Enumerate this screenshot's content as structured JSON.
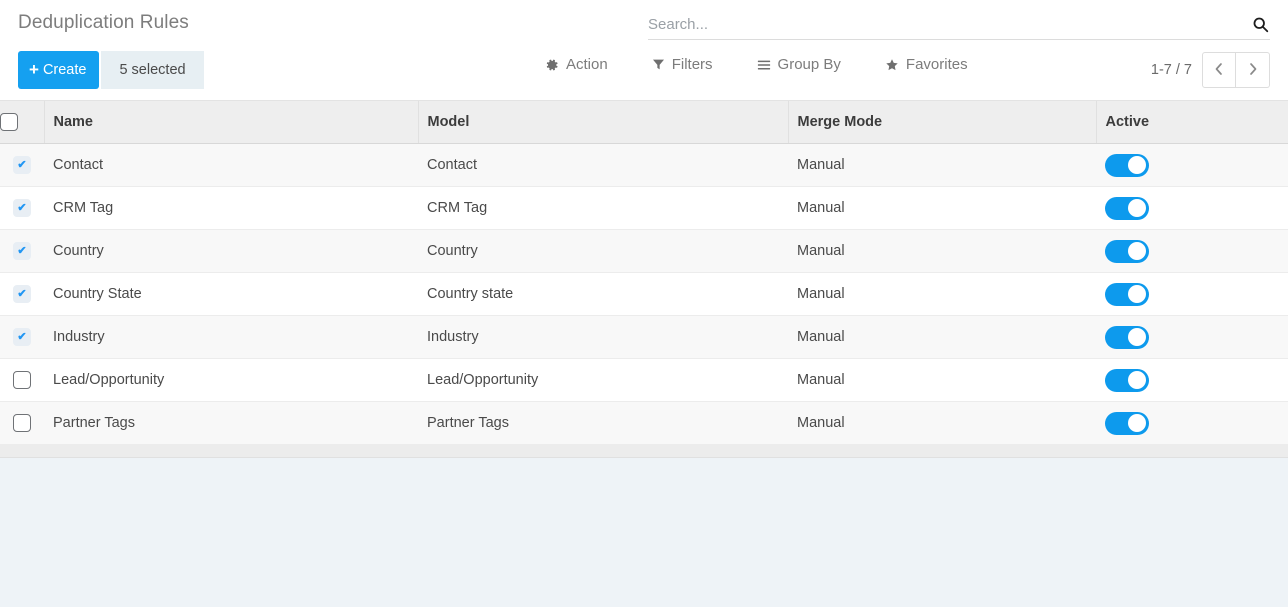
{
  "breadcrumb": "Deduplication Rules",
  "search": {
    "placeholder": "Search...",
    "value": "",
    "icon": "search-icon"
  },
  "toolbar": {
    "create_label": "Create",
    "create_icon": "plus-icon",
    "selected_label": "5 selected",
    "items": [
      {
        "label": "Action",
        "icon": "gear-icon"
      },
      {
        "label": "Filters",
        "icon": "filter-icon"
      },
      {
        "label": "Group By",
        "icon": "list-icon"
      },
      {
        "label": "Favorites",
        "icon": "star-icon"
      }
    ]
  },
  "pager": {
    "range": "1-7 / 7",
    "prev_icon": "chevron-left-icon",
    "next_icon": "chevron-right-icon"
  },
  "table": {
    "select_all_checked": false,
    "columns": [
      "Name",
      "Model",
      "Merge Mode",
      "Active"
    ],
    "rows": [
      {
        "checked": true,
        "name": "Contact",
        "model": "Contact",
        "merge_mode": "Manual",
        "active": true
      },
      {
        "checked": true,
        "name": "CRM Tag",
        "model": "CRM Tag",
        "merge_mode": "Manual",
        "active": true
      },
      {
        "checked": true,
        "name": "Country",
        "model": "Country",
        "merge_mode": "Manual",
        "active": true
      },
      {
        "checked": true,
        "name": "Country State",
        "model": "Country state",
        "merge_mode": "Manual",
        "active": true
      },
      {
        "checked": true,
        "name": "Industry",
        "model": "Industry",
        "merge_mode": "Manual",
        "active": true
      },
      {
        "checked": false,
        "name": "Lead/Opportunity",
        "model": "Lead/Opportunity",
        "merge_mode": "Manual",
        "active": true
      },
      {
        "checked": false,
        "name": "Partner Tags",
        "model": "Partner Tags",
        "merge_mode": "Manual",
        "active": true
      }
    ]
  },
  "colors": {
    "accent": "#15a0f0",
    "toggle_on": "#0d9aed",
    "page_background": "#eef3f7",
    "header_background": "#eeeeee",
    "selected_badge_background": "#e7eff3"
  }
}
